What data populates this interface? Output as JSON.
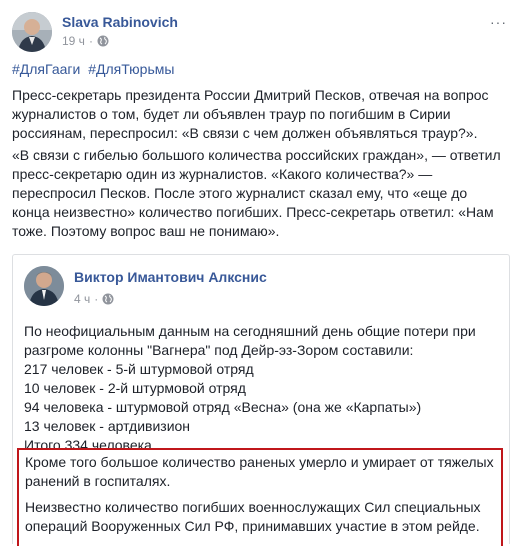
{
  "post": {
    "author": "Slava Rabinovich",
    "time": "19 ч",
    "dot": "·",
    "more": "···",
    "hashtags": [
      "#ДляГааги",
      "#ДляТюрьмы"
    ],
    "paragraph1": "Пресс-секретарь президента России Дмитрий Песков, отвечая на вопрос журналистов о том, будет ли объявлен траур по погибшим в Сирии россиянам, переспросил: «В связи с чем должен объявляться траур?».",
    "paragraph2": "«В связи с гибелью большого количества российских граждан», — ответил пресс-секретарю один из журналистов. «Какого количества?» — переспросил Песков. После этого журналист сказал ему, что «еще до конца неизвестно» количество погибших. Пресс-секретарь ответил: «Нам тоже. Поэтому вопрос ваш не понимаю»."
  },
  "shared_post": {
    "author": "Виктор Имантович Алкснис",
    "time": "4 ч",
    "dot": "·",
    "lines": [
      "По неофициальным данным на сегодняшний день общие потери при",
      "разгроме колонны \"Вагнера\" под Дейр-эз-Зором составили:",
      "217 человек - 5-й штурмовой отряд",
      "10 человек - 2-й штурмовой отряд",
      "94 человека - штурмовой отряд «Весна» (она же «Карпаты»)",
      "13 человек - артдивизион",
      "Итого 334 человека."
    ],
    "highlight1": "Кроме того большое количество раненых умерло и умирает от тяжелых ранений в госпиталях.",
    "highlight2": "Неизвестно количество погибших военнослужащих Сил специальных операций Вооруженных Сил РФ, принимавших участие в этом рейде."
  },
  "colors": {
    "link": "#385898",
    "text": "#1d2129",
    "meta": "#90949c",
    "highlight_border": "#c0171b"
  },
  "icons": [
    "avatar",
    "globe-icon",
    "more-icon"
  ]
}
